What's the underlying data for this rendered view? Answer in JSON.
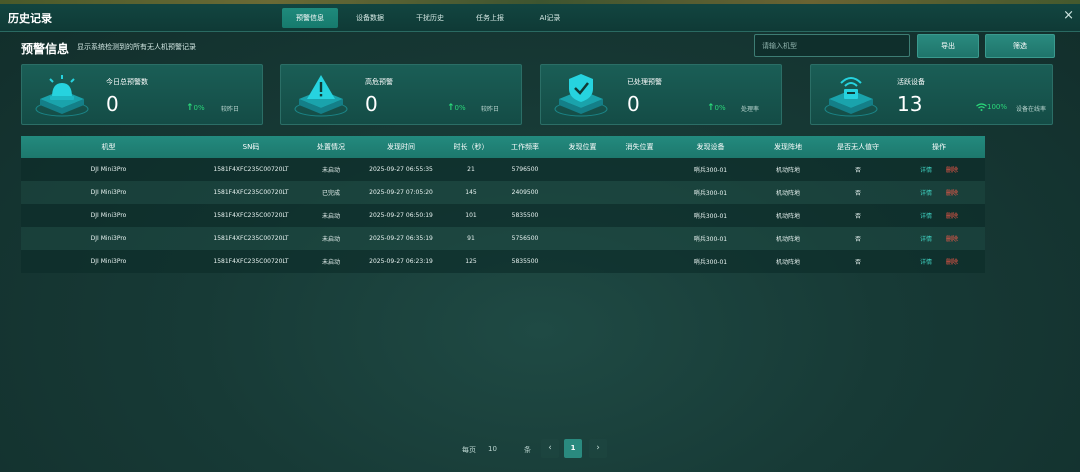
{
  "window": {
    "title": "历史记录",
    "close": "×"
  },
  "tabs": [
    {
      "label": "预警信息",
      "active": true
    },
    {
      "label": "设备数据",
      "active": false
    },
    {
      "label": "干扰历史",
      "active": false
    },
    {
      "label": "任务上报",
      "active": false
    },
    {
      "label": "AI记录",
      "active": false
    }
  ],
  "header": {
    "title": "预警信息",
    "subtitle": "显示系统检测到的所有无人机预警记录",
    "search_placeholder": "请输入机型",
    "export_label": "导出",
    "filter_label": "筛选"
  },
  "cards": [
    {
      "icon": "alarm-light-icon",
      "label": "今日总预警数",
      "value": "0",
      "trend_arrow": "↑",
      "trend": "0%",
      "note": "较昨日"
    },
    {
      "icon": "warning-triangle-icon",
      "label": "高危预警",
      "value": "0",
      "trend_arrow": "↑",
      "trend": "0%",
      "note": "较昨日"
    },
    {
      "icon": "shield-check-icon",
      "label": "已处理预警",
      "value": "0",
      "trend_arrow": "↑",
      "trend": "0%",
      "note": "处理率"
    },
    {
      "icon": "radar-device-icon",
      "label": "活跃设备",
      "value": "13",
      "trend_arrow": "wifi",
      "trend": "100%",
      "note": "设备在线率"
    }
  ],
  "table": {
    "columns": [
      "机型",
      "SN码",
      "处置情况",
      "发现时间",
      "时长（秒）",
      "工作频率",
      "发现位置",
      "消失位置",
      "发现设备",
      "发现阵地",
      "是否无人值守",
      "操作"
    ],
    "rows": [
      [
        "DJI Mini3Pro",
        "1581F4XFC235C00720LT",
        "未启动",
        "2025-09-27 06:55:35",
        "21",
        "5796500",
        "",
        "",
        "哨兵300-01",
        "机动阵地",
        "否"
      ],
      [
        "DJI Mini3Pro",
        "1581F4XFC235C00720LT",
        "已完成",
        "2025-09-27 07:05:20",
        "145",
        "2409500",
        "",
        "",
        "哨兵300-01",
        "机动阵地",
        "否"
      ],
      [
        "DJI Mini3Pro",
        "1581F4XFC235C00720LT",
        "未启动",
        "2025-09-27 06:50:19",
        "101",
        "5835500",
        "",
        "",
        "哨兵300-01",
        "机动阵地",
        "否"
      ],
      [
        "DJI Mini3Pro",
        "1581F4XFC235C00720LT",
        "未启动",
        "2025-09-27 06:35:19",
        "91",
        "5756500",
        "",
        "",
        "哨兵300-01",
        "机动阵地",
        "否"
      ],
      [
        "DJI Mini3Pro",
        "1581F4XFC235C00720LT",
        "未启动",
        "2025-09-27 06:23:19",
        "125",
        "5835500",
        "",
        "",
        "哨兵300-01",
        "机动阵地",
        "否"
      ]
    ],
    "action_detail": "详情",
    "action_delete": "删除"
  },
  "pagination": {
    "per_page_label": "每页",
    "per_page": "10",
    "unit": "条",
    "current_page": "1",
    "prev": "‹",
    "next": "›"
  },
  "colors": {
    "accent": "#1f8a7c",
    "trend_up": "#2bd97a",
    "delete": "#ff5a4a",
    "detail": "#3fd0c0",
    "icon": "#22c9d4"
  }
}
